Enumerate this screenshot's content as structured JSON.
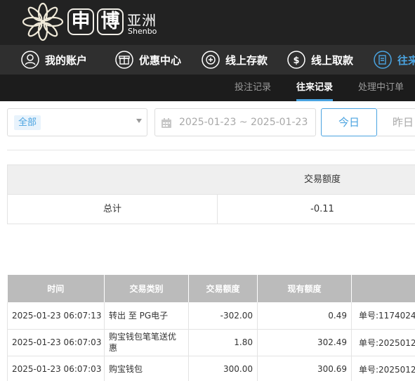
{
  "brand": {
    "char1": "申",
    "char2": "博",
    "cn": "亚洲",
    "en": "Shenbo",
    "accent": "#4aa3e0"
  },
  "nav": {
    "items": [
      {
        "label": "我的账户",
        "icon": "user-icon"
      },
      {
        "label": "优惠中心",
        "icon": "gift-icon"
      },
      {
        "label": "线上存款",
        "icon": "deposit-icon"
      },
      {
        "label": "线上取款",
        "icon": "withdraw-icon"
      },
      {
        "label": "往来",
        "icon": "records-icon"
      }
    ]
  },
  "subnav": {
    "items": [
      {
        "label": "投注记录"
      },
      {
        "label": "往来记录"
      },
      {
        "label": "处理中订单"
      }
    ],
    "active": "往来记录"
  },
  "filter": {
    "type_selected": "全部",
    "date_range": "2025-01-23 ~ 2025-01-23",
    "today_label": "今日",
    "yesterday_label": "昨日"
  },
  "summary": {
    "header_amount": "交易额度",
    "total_label": "总计",
    "total_value": "-0.11"
  },
  "records": {
    "columns": [
      "时间",
      "交易类别",
      "交易额度",
      "现有额度",
      ""
    ],
    "rows": [
      {
        "time": "2025-01-23 06:07:13",
        "type": "转出 至 PG电子",
        "amount": "-302.00",
        "balance": "0.49",
        "note": "单号:1174024"
      },
      {
        "time": "2025-01-23 06:07:03",
        "type": "购宝钱包笔笔送优惠",
        "amount": "1.80",
        "balance": "302.49",
        "note": "单号:2025012"
      },
      {
        "time": "2025-01-23 06:07:03",
        "type": "购宝钱包",
        "amount": "300.00",
        "balance": "300.69",
        "note": "单号:2025012"
      }
    ]
  }
}
